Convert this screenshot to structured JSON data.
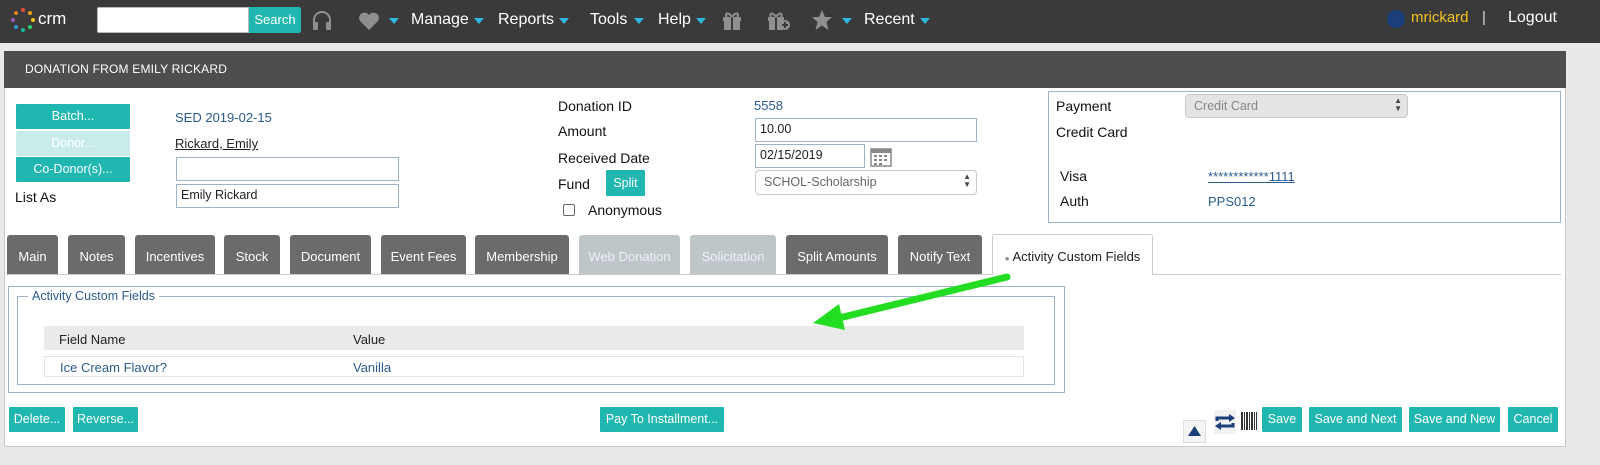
{
  "nav": {
    "logo_text": "crm",
    "search_placeholder": "",
    "search_button": "Search",
    "items": [
      "Manage",
      "Reports",
      "Tools",
      "Help",
      "Recent"
    ],
    "username": "mrickard",
    "separator": "|",
    "logout": "Logout"
  },
  "panel": {
    "title": "DONATION FROM EMILY RICKARD"
  },
  "left": {
    "batch_button": "Batch...",
    "donor_button": "Donor...",
    "codonor_button": "Co-Donor(s)...",
    "batch_value": "SED 2019-02-15",
    "donor_value": "Rickard, Emily",
    "codonor_value": "",
    "list_as_label": "List As",
    "list_as_value": "Emily Rickard"
  },
  "middle": {
    "donation_id_label": "Donation ID",
    "donation_id_value": "5558",
    "amount_label": "Amount",
    "amount_value": "10.00",
    "received_date_label": "Received Date",
    "received_date_value": "02/15/2019",
    "fund_label": "Fund",
    "split_button": "Split",
    "fund_value": "SCHOL-Scholarship",
    "anonymous_label": "Anonymous"
  },
  "payment": {
    "payment_label": "Payment",
    "payment_value": "Credit Card",
    "credit_card_label": "Credit Card",
    "visa_label": "Visa",
    "visa_value": "************1111",
    "auth_label": "Auth",
    "auth_value": "PPS012"
  },
  "tabs": [
    "Main",
    "Notes",
    "Incentives",
    "Stock",
    "Document",
    "Event Fees",
    "Membership",
    "Web Donation",
    "Solicitation",
    "Split Amounts",
    "Notify Text",
    "Activity Custom Fields"
  ],
  "custom_fields": {
    "legend": "Activity Custom Fields",
    "col_field_name": "Field Name",
    "col_value": "Value",
    "rows": [
      {
        "field": "Ice Cream Flavor?",
        "value": "Vanilla"
      }
    ]
  },
  "footer": {
    "delete": "Delete...",
    "reverse": "Reverse...",
    "pay_installment": "Pay To Installment...",
    "save": "Save",
    "save_next": "Save and Next",
    "save_new": "Save and New",
    "cancel": "Cancel"
  },
  "colors": {
    "accent": "#20b7b1",
    "nav_bg": "#3a3a3a",
    "arrow": "#22dd22",
    "username": "#f3c21b"
  }
}
